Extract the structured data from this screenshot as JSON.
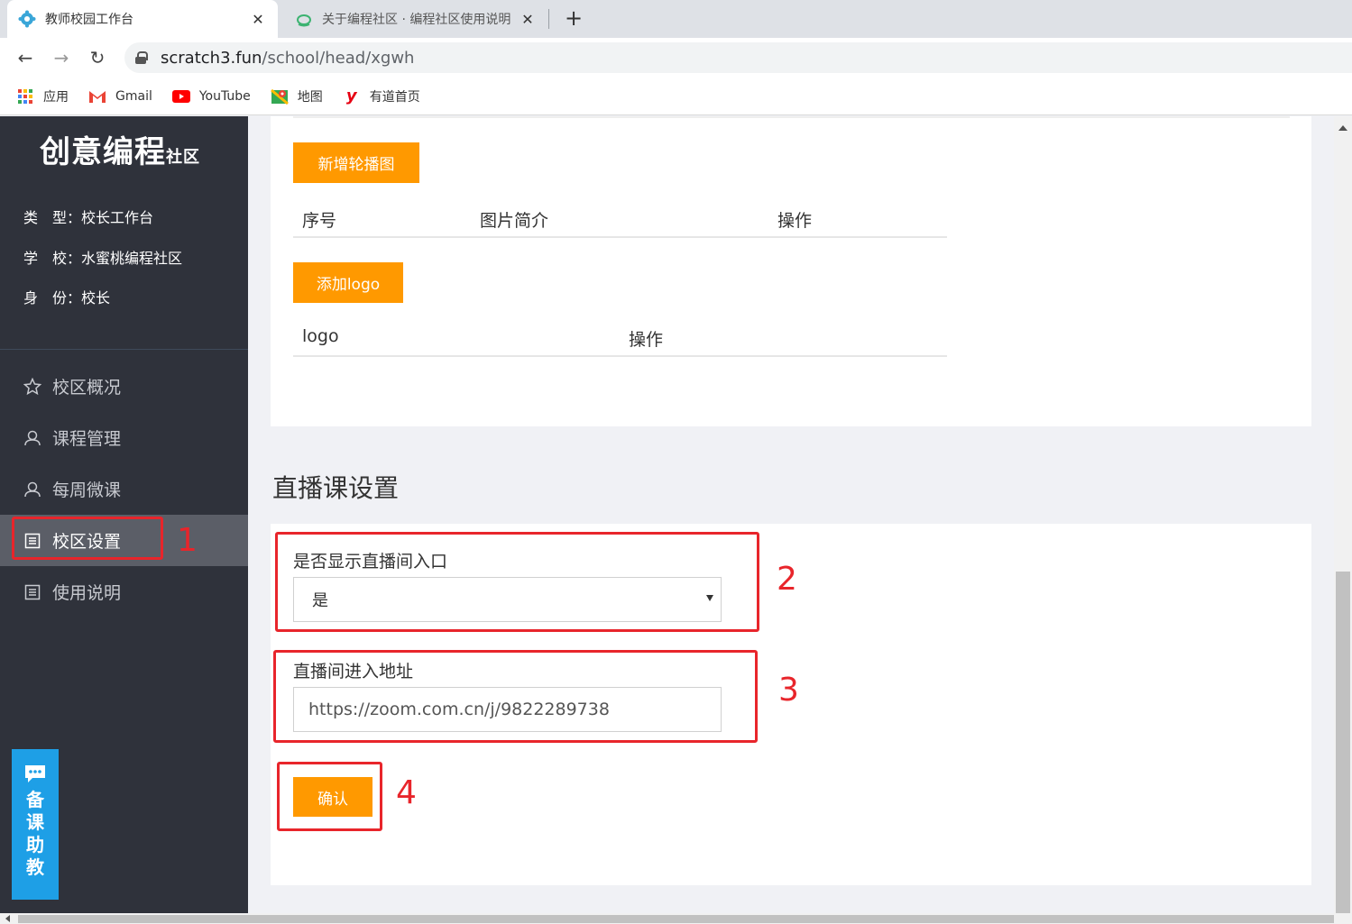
{
  "browser": {
    "tabs": [
      {
        "title": "教师校园工作台",
        "icon": "gear-flower-icon"
      },
      {
        "title": "关于编程社区 · 编程社区使用说明",
        "icon": "cloud-icon"
      }
    ],
    "new_tab": "+",
    "url_host": "scratch3.fun",
    "url_path": "/school/head/xgwh",
    "bookmarks": [
      {
        "label": "应用",
        "icon": "apps-grid-icon"
      },
      {
        "label": "Gmail",
        "icon": "gmail-icon"
      },
      {
        "label": "YouTube",
        "icon": "youtube-icon"
      },
      {
        "label": "地图",
        "icon": "maps-icon"
      },
      {
        "label": "有道首页",
        "icon": "youdao-icon"
      }
    ]
  },
  "sidebar": {
    "logo_main": "创意编程",
    "logo_sub": "社区",
    "info": [
      {
        "label": "类　型：",
        "value": "校长工作台"
      },
      {
        "label": "学　校：",
        "value": "水蜜桃编程社区"
      },
      {
        "label": "身　份：",
        "value": "校长"
      }
    ],
    "menu": [
      {
        "label": "校区概况",
        "icon": "star-icon"
      },
      {
        "label": "课程管理",
        "icon": "user-icon"
      },
      {
        "label": "每周微课",
        "icon": "user-icon"
      },
      {
        "label": "校区设置",
        "icon": "document-icon"
      },
      {
        "label": "使用说明",
        "icon": "document-icon"
      }
    ],
    "assistant_label": "备课助教"
  },
  "carousel": {
    "add_button": "新增轮播图",
    "columns": [
      "序号",
      "图片简介",
      "操作"
    ]
  },
  "logo_section": {
    "add_button": "添加logo",
    "columns": [
      "logo",
      "操作"
    ]
  },
  "live": {
    "title": "直播课设置",
    "show_label": "是否显示直播间入口",
    "show_value": "是",
    "url_label": "直播间进入地址",
    "url_value": "https://zoom.com.cn/j/9822289738",
    "confirm": "确认"
  },
  "annotations": [
    "1",
    "2",
    "3",
    "4"
  ],
  "colors": {
    "sidebar_bg": "#2f323b",
    "accent_orange": "#ff9900",
    "annotation_red": "#e8252b",
    "assistant_blue": "#1e9fe6"
  }
}
